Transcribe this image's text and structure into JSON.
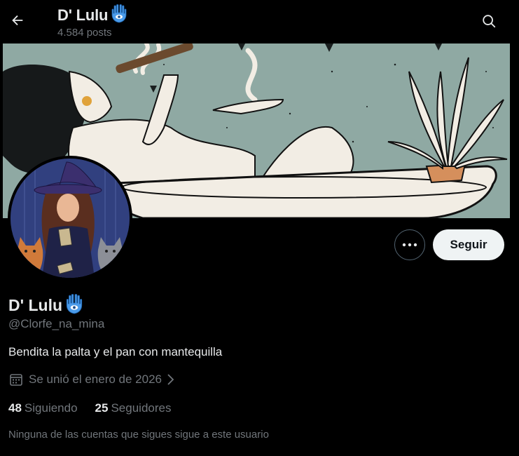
{
  "header": {
    "title": "D' Lulu",
    "posts_count": "4.584 posts",
    "back_icon": "arrow-left-icon",
    "search_icon": "search-icon"
  },
  "banner": {
    "description_icon": "banner-illustration"
  },
  "actions": {
    "more_icon": "more-dots-icon",
    "follow_label": "Seguir"
  },
  "profile": {
    "name": "D' Lulu",
    "emoji_icon": "hamsa-icon",
    "handle": "@Clorfe_na_mina",
    "bio": "Bendita la palta y el pan con mantequilla",
    "joined": "Se unió el enero de 2026",
    "following_count": "48",
    "following_label": "Siguiendo",
    "followers_count": "25",
    "followers_label": "Seguidores",
    "followers_note": "Ninguna de las cuentas que sigues sigue a este usuario"
  },
  "colors": {
    "background": "#000000",
    "text_primary": "#e7e9ea",
    "text_secondary": "#71767b",
    "follow_bg": "#eff3f4",
    "hamsa_blue": "#3a8de0"
  }
}
